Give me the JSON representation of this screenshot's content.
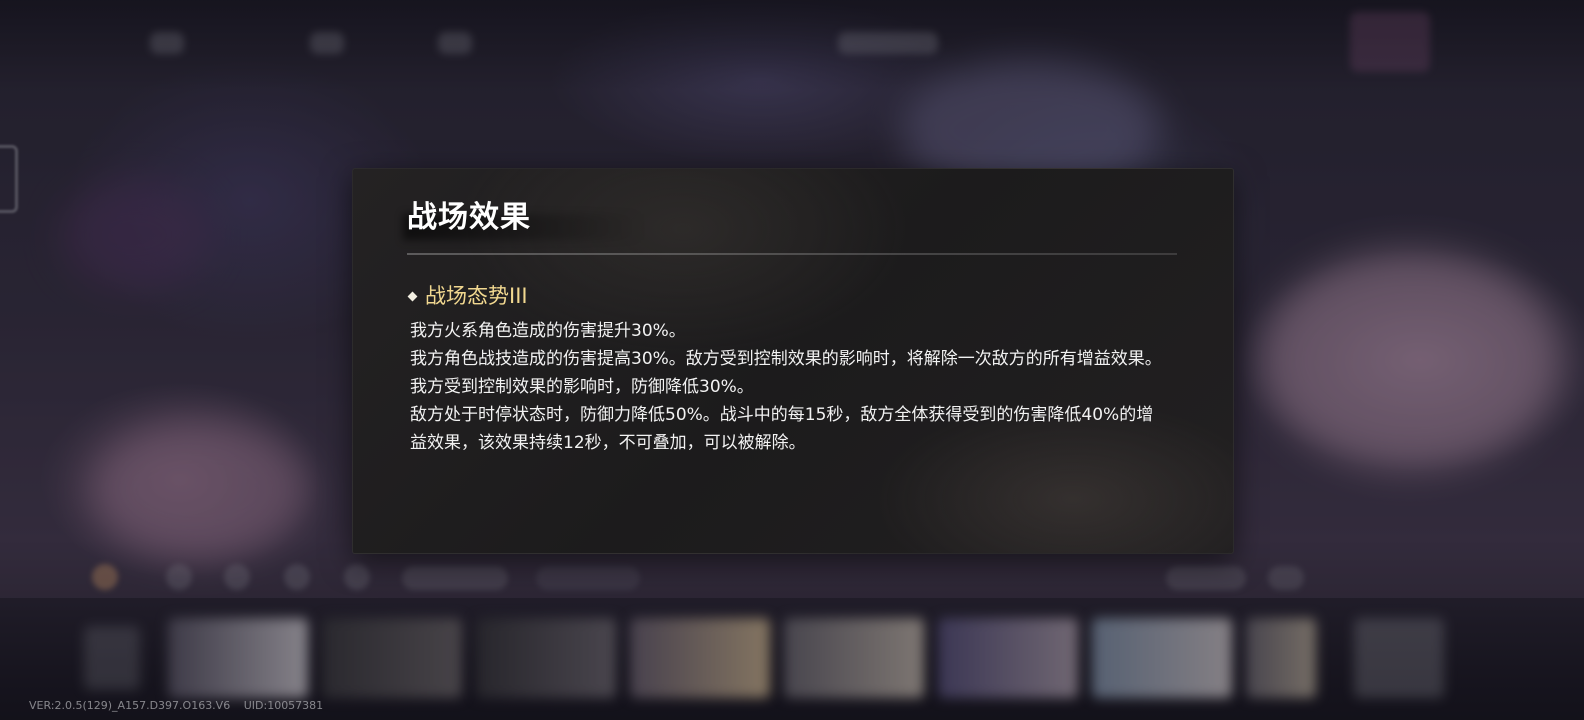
{
  "dialog": {
    "title": "战场效果",
    "effect": {
      "name": "战场态势III",
      "lines": [
        "我方火系角色造成的伤害提升30%。",
        "我方角色战技造成的伤害提高30%。敌方受到控制效果的影响时，将解除一次敌方的所有增益效果。我方受到控制效果的影响时，防御降低30%。",
        "敌方处于时停状态时，防御力降低50%。战斗中的每15秒，敌方全体获得受到的伤害降低40%的增益效果，该效果持续12秒，不可叠加，可以被解除。"
      ]
    }
  },
  "footer": {
    "version": "VER:2.0.5(129)_A157.D397.O163.V6",
    "uid": "UID:10057381"
  },
  "colors": {
    "effect_name": "#f1d890",
    "dialog_bg": "#1e1d1e"
  }
}
